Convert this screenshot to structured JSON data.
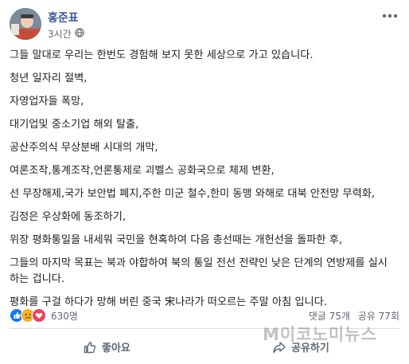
{
  "author": {
    "name": "홍준표",
    "time": "3시간"
  },
  "paragraphs": [
    "그들 말대로 우리는 한번도 경험해 보지 못한 세상으로 가고 있습니다.",
    "청년 일자리 절벽,",
    "자영업자들 폭망,",
    "대기업및 중소기업 해외 탈출,",
    "공산주의식 무상분배 시대의 개막,",
    "여론조작,통계조작,언론통제로 괴벨스 공화국으로 체제 변환,",
    "선 무장해제,국가 보안법 폐지,주한 미군 철수,한미 동맹 와해로 대북 안전망 무력화,",
    "김정은 우상화에 동조하기,",
    "위장 평화통일을 내세워 국민을 현혹하여 다음 총선때는 개헌선을 돌파한 후,",
    "그들의 마지막 목표는 북과 야합하여 북의 통일 전선 전략인 낮은 단계의 연방제를 실시 하는 겁니다.",
    "평화를 구걸 하다가 망해 버린 중국 宋나라가 떠오르는 주말 아침 입니다."
  ],
  "stats": {
    "reactions": "630명",
    "comments": "댓글 75개",
    "shares": "공유 77회"
  },
  "actions": {
    "like": "좋아요",
    "share": "공유하기"
  },
  "watermark": "M이코노미뉴스",
  "icons": {
    "privacy": "globe-icon",
    "menu": "more-dots-icon",
    "like": "thumbs-up-icon",
    "share": "share-arrow-icon"
  },
  "colors": {
    "author": "#385898",
    "like": "#1877f2",
    "sad": "#f7b125",
    "love": "#f33e58"
  }
}
